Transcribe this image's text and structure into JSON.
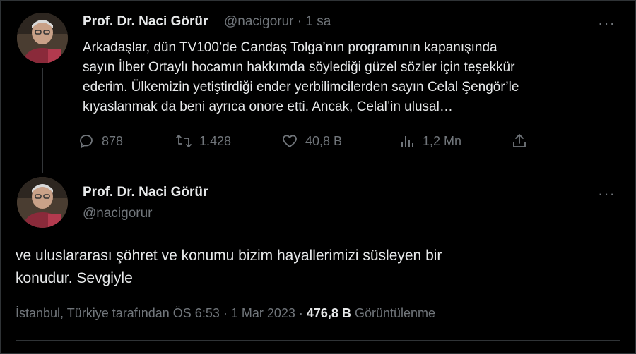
{
  "first_tweet": {
    "author_name": "Prof. Dr. Naci Görür",
    "handle_time": "@nacigorur · 1 sa",
    "more_label": "···",
    "text": "Arkadaşlar, dün TV100’de Candaş Tolga’nın programının kapanışında\nsayın İlber Ortaylı hocamın hakkımda söylediği güzel sözler için teşekkür\nederim. Ülkemizin yetiştirdiği ender yerbilimcilerden sayın Celal Şengör’le\nkıyaslanmak da beni ayrıca onore etti. Ancak, Celal’in ulusal…",
    "actions": {
      "reply_icon": "reply-icon",
      "reply_count": "878",
      "retweet_icon": "retweet-icon",
      "retweet_count": "1.428",
      "like_icon": "heart-icon",
      "like_count": "40,8 B",
      "views_icon": "bar-chart-icon",
      "views_count": "1,2 Mn",
      "share_icon": "share-icon"
    }
  },
  "second_tweet": {
    "author_name": "Prof. Dr. Naci Görür",
    "handle": "@nacigorur",
    "more_label": "···",
    "text": "ve uluslararası şöhret ve konumu bizim hayallerimizi süsleyen bir\nkonudur. Sevgiyle",
    "meta_location_time": "İstanbul, Türkiye tarafından ÖS 6:53 · 1 Mar 2023 · ",
    "meta_views_count": "476,8 B",
    "meta_views_label": " Görüntülenme"
  },
  "colors": {
    "background": "#000000",
    "text_primary": "#e7e9ea",
    "text_secondary": "#71767b",
    "border": "#2f3336"
  }
}
